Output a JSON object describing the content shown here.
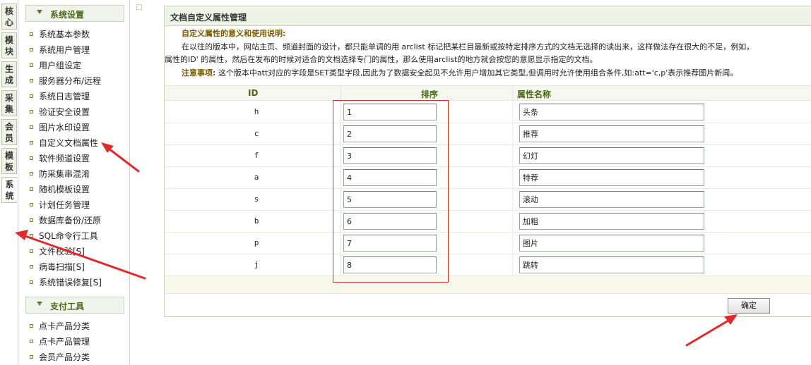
{
  "vtabs": [
    {
      "label": "核心"
    },
    {
      "label": "模块"
    },
    {
      "label": "生成"
    },
    {
      "label": "采集"
    },
    {
      "label": "会员"
    },
    {
      "label": "模板"
    },
    {
      "label": "系统",
      "active": true
    }
  ],
  "nav": {
    "section1": "系统设置",
    "items1": [
      "系统基本参数",
      "系统用户管理",
      "用户组设定",
      "服务器分布/远程",
      "系统日志管理",
      "验证安全设置",
      "图片水印设置",
      "自定义文档属性",
      "软件频道设置",
      "防采集串混淆",
      "随机模板设置",
      "计划任务管理",
      "数据库备份/还原",
      "SQL命令行工具",
      "文件校验[S]",
      "病毒扫描[S]",
      "系统错误修复[S]"
    ],
    "section2": "支付工具",
    "items2": [
      "点卡产品分类",
      "点卡产品管理",
      "会员产品分类"
    ]
  },
  "panel": {
    "title": "文档自定义属性管理",
    "desc_heading": "自定义属性的意义和使用说明:",
    "desc_line1": "在以往的版本中，网站主页、频道封面的设计，都只能单调的用 arclist 标记把某栏目最新或按特定排序方式的文档无选择的读出来，这样做法存在很大的不足，例如，",
    "desc_line2": "属性的ID' 的属性，然后在发布的时候对适合的文档选择专门的属性，那么使用arclist的地方就会按您的意愿显示指定的文档。",
    "note_label": "注意事项:",
    "note_text": "这个版本中att对应的字段是SET类型字段,因此为了数据安全起见不允许用户增加其它类型,但调用时允许使用组合条件,如:att='c,p'表示推荐图片新闻。",
    "col_id": "ID",
    "col_rank": "排序",
    "col_name": "属性名称",
    "rows": [
      {
        "id": "h",
        "rank": "1",
        "name": "头条"
      },
      {
        "id": "c",
        "rank": "2",
        "name": "推荐"
      },
      {
        "id": "f",
        "rank": "3",
        "name": "幻灯"
      },
      {
        "id": "a",
        "rank": "4",
        "name": "特荐"
      },
      {
        "id": "s",
        "rank": "5",
        "name": "滚动"
      },
      {
        "id": "b",
        "rank": "6",
        "name": "加粗"
      },
      {
        "id": "p",
        "rank": "7",
        "name": "图片"
      },
      {
        "id": "j",
        "rank": "8",
        "name": "跳转"
      }
    ],
    "ok_label": "确定"
  },
  "colors": {
    "annotation": "#e02b2b",
    "accent_green": "#4a6a18",
    "header_bg": "#eef3e7"
  }
}
